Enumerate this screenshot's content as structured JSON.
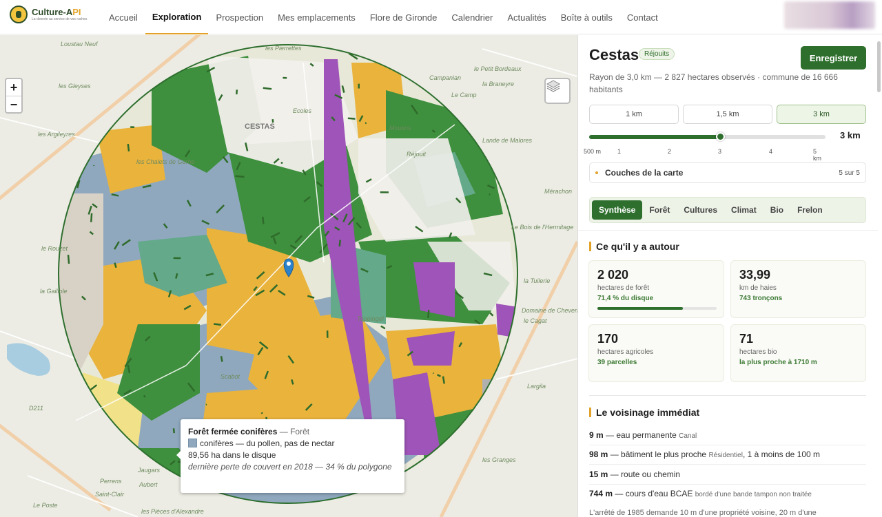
{
  "brand": {
    "name_start": "Culture-A",
    "name_accent": "PI",
    "tagline": "La donnée au service de vos ruches"
  },
  "nav": [
    "Accueil",
    "Exploration",
    "Prospection",
    "Mes emplacements",
    "Flore de Gironde",
    "Calendrier",
    "Actualités",
    "Boîte à outils",
    "Contact"
  ],
  "nav_active": "Exploration",
  "map": {
    "labels": [
      "Loustau Neuf",
      "les Pierrettes",
      "le Petit Bordeaux",
      "Campanian",
      "la Braneyre",
      "les Gleyses",
      "Le Camp",
      "Lande de Malores",
      "les Argileyres",
      "Mérachon",
      "Le Bois de l'Hermitage",
      "le Rouzet",
      "la Gaillole",
      "la Tuilerie",
      "Domaine de Cheverny",
      "le Cagat",
      "Largila",
      "D211",
      "Perrens",
      "Saint-Clair",
      "Jaugars",
      "Aubert",
      "les Granges",
      "Le Poste",
      "les Pièces d'Alexandre",
      "CESTAS",
      "les Chalets de Gerbe",
      "Ecoles",
      "Moutins",
      "Réjouit",
      "Toppingel",
      "Scabot"
    ],
    "colors": {
      "forest": "#3e8f3e",
      "conifers": "#8fa8be",
      "crops": "#e9b33c",
      "bio": "#9e54b8",
      "meadow": "#63a98a",
      "light_green": "#8fc27a",
      "bare": "#d8d2c6",
      "urban": "#f2f0ec"
    }
  },
  "zoom": {
    "in": "+",
    "out": "−"
  },
  "tooltip": {
    "title": "Forêt fermée conifères",
    "category": "— Forêt",
    "line1": "conifères — du pollen, pas de nectar",
    "line2": "89,56 ha dans le disque",
    "note": "dernière perte de couvert en 2018 — 34 % du polygone"
  },
  "panel": {
    "title": "Cestas",
    "badge": "Réjouits",
    "save_label": "Enregistrer",
    "subtitle": "Rayon de 3,0 km — 2 827 hectares observés · commune de 16 666 habitants",
    "radius_options": [
      "1 km",
      "1,5 km",
      "3 km"
    ],
    "radius_selected": "3 km",
    "slider_value": "3 km",
    "slider_fraction": 0.555,
    "ticks": [
      "500 m",
      "1",
      "2",
      "3",
      "4",
      "5 km"
    ],
    "layers_label": "Couches de la carte",
    "layers_count": "5 sur 5",
    "tabs": [
      "Synthèse",
      "Forêt",
      "Cultures",
      "Climat",
      "Bio",
      "Frelon"
    ],
    "tab_active": "Synthèse",
    "around_title": "Ce qu'il y a autour",
    "cards": [
      {
        "num": "2 020",
        "unit": "hectares de forêt",
        "note": "71,4 % du disque",
        "progress": 0.714
      },
      {
        "num": "33,99",
        "unit": "km de haies",
        "note": "743 tronçons"
      },
      {
        "num": "170",
        "unit": "hectares agricoles",
        "note": "39 parcelles"
      },
      {
        "num": "71",
        "unit": "hectares bio",
        "note": "la plus proche à 1710 m"
      }
    ],
    "nearby_title": "Le voisinage immédiat",
    "nearby": [
      {
        "dist": "9 m",
        "text": "— eau permanente",
        "small": "Canal",
        "extra": ""
      },
      {
        "dist": "98 m",
        "text": "— bâtiment le plus proche",
        "small": "Résidentiel",
        "extra": ", 1 à moins de 100 m"
      },
      {
        "dist": "15 m",
        "text": "— route ou chemin",
        "small": "",
        "extra": ""
      },
      {
        "dist": "744 m",
        "text": "— cours d'eau BCAE",
        "small": "bordé d'une bande tampon non traitée",
        "extra": ""
      }
    ],
    "cut_text": "L'arrêté de 1985 demande 10 m d'une propriété voisine, 20 m d'une"
  }
}
